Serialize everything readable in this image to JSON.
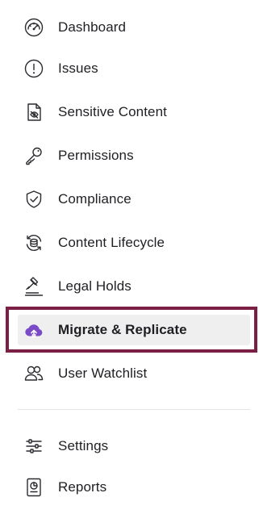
{
  "nav": {
    "items": [
      {
        "label": "Dashboard",
        "icon": "gauge-icon"
      },
      {
        "label": "Issues",
        "icon": "alert-circle-icon"
      },
      {
        "label": "Sensitive Content",
        "icon": "document-hidden-icon"
      },
      {
        "label": "Permissions",
        "icon": "key-icon"
      },
      {
        "label": "Compliance",
        "icon": "shield-check-icon"
      },
      {
        "label": "Content Lifecycle",
        "icon": "lifecycle-database-icon"
      },
      {
        "label": "Legal Holds",
        "icon": "gavel-icon"
      },
      {
        "label": "Migrate & Replicate",
        "icon": "cloud-upload-icon",
        "active": true
      },
      {
        "label": "User Watchlist",
        "icon": "users-icon"
      }
    ],
    "bottom_items": [
      {
        "label": "Settings",
        "icon": "sliders-icon"
      },
      {
        "label": "Reports",
        "icon": "report-icon"
      }
    ]
  },
  "colors": {
    "highlight_border": "#7c1f45",
    "active_background": "#efefef",
    "active_icon": "#7b4bc7"
  }
}
